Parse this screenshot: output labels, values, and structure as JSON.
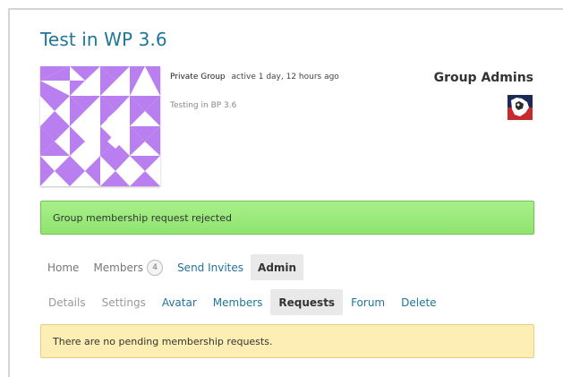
{
  "group": {
    "title": "Test in WP 3.6",
    "status": "Private Group",
    "activity": "active 1 day, 12 hours ago",
    "description": "Testing in BP 3.6",
    "avatar_color": "#b97ff0"
  },
  "admins": {
    "heading": "Group Admins"
  },
  "notice": {
    "message": "Group membership request rejected",
    "color": "#9be77d"
  },
  "tabs": [
    {
      "label": "Home"
    },
    {
      "label": "Members",
      "count": "4"
    },
    {
      "label": "Send Invites"
    },
    {
      "label": "Admin"
    }
  ],
  "subtabs": [
    {
      "label": "Details"
    },
    {
      "label": "Settings"
    },
    {
      "label": "Avatar"
    },
    {
      "label": "Members"
    },
    {
      "label": "Requests"
    },
    {
      "label": "Forum"
    },
    {
      "label": "Delete"
    }
  ],
  "info": {
    "message": "There are no pending membership requests.",
    "color": "#fdefb3"
  }
}
